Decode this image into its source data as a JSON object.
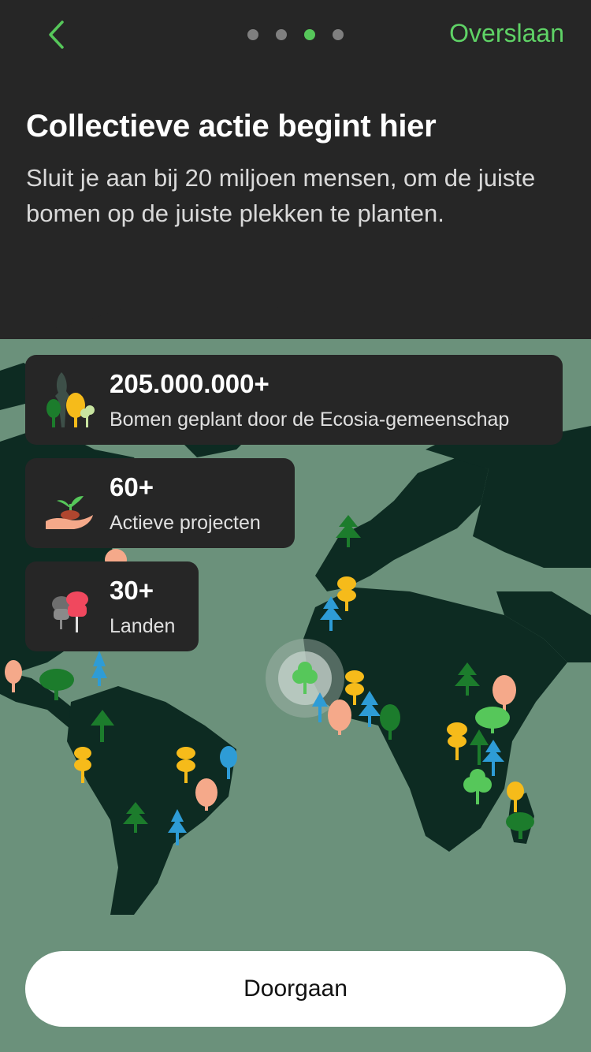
{
  "header": {
    "back_icon": "chevron-left-icon",
    "skip_label": "Overslaan",
    "pager": {
      "total": 4,
      "active_index": 3
    }
  },
  "intro": {
    "title": "Collectieve actie begint hier",
    "subtitle": "Sluit je aan bij 20 miljoen mensen, om de juiste bomen op de juiste plekken te planten."
  },
  "stats": [
    {
      "value": "205.000.000+",
      "label": "Bomen geplant door de Ecosia-gemeenschap",
      "icon": "trees-icon"
    },
    {
      "value": "60+",
      "label": "Actieve projecten",
      "icon": "hand-seedling-icon"
    },
    {
      "value": "30+",
      "label": "Landen",
      "icon": "map-pins-icon"
    }
  ],
  "cta": {
    "label": "Doorgaan"
  },
  "colors": {
    "accent": "#56c75a",
    "header_bg": "#262626",
    "ocean": "#6b917b",
    "land": "#0d2b22",
    "card_bg": "#262626"
  }
}
